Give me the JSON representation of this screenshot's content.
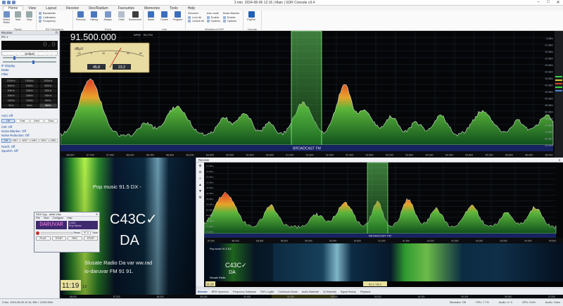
{
  "window": {
    "title": "3 min. 2024-08-06 12:16 | Main | SDR Console v3.4"
  },
  "menu": {
    "tabs": [
      "Home",
      "View",
      "Layout",
      "Receive",
      "Rec/Radium",
      "Favourites",
      "Memories",
      "Tools",
      "Help"
    ],
    "active_index": 0
  },
  "ribbon": {
    "groups": [
      {
        "name": "Radio",
        "buttons": [
          "Select Radio",
          "Start",
          "Stop"
        ]
      },
      {
        "name": "RX Frequency",
        "small": [
          "Bandwidth",
          "Calibration",
          "Frequency"
        ]
      },
      {
        "name": "Extra",
        "buttons": [
          "Previous",
          "History",
          "Always",
          "Child",
          "Screenshot"
        ]
      },
      {
        "name": "Link",
        "buttons": [
          "Radio",
          "Centre",
          "Program"
        ]
      },
      {
        "name": "Wideband DSP",
        "small": [
          "Receiver",
          "Lock All",
          "Unlock All",
          "Auto-mute",
          "Enable",
          "Options",
          "Noise Blanker",
          "Enable",
          "Options"
        ]
      },
      {
        "name": "Donate",
        "buttons": [
          "PayPal"
        ]
      }
    ]
  },
  "left_panel": {
    "receive_header": "Receive",
    "rx_label": "RX 1",
    "frequency_dim": "0.0",
    "frequency": "91.500.000",
    "rx_mode_label": "Default",
    "sections": [
      "IF Display",
      "Mode",
      "Filter"
    ],
    "bandwidths": [
      "200kHz",
      "150kHz",
      "100kHz",
      "80kHz",
      "60kHz",
      "50kHz",
      "40kHz",
      "30kHz",
      "25kHz",
      "20kHz",
      "18kHz",
      "15kHz",
      "12kHz",
      "10kHz",
      "8kHz",
      "7kHz",
      "6kHz",
      "5kHz"
    ],
    "selected_bandwidth_index": 17,
    "agc_title": "AGC Off",
    "agc_buttons": [
      "Off",
      "Fast",
      "Med",
      "Slow"
    ],
    "cw_title": "CW: Off",
    "noise_blanker_title": "Noise Blanker: Off",
    "noise_reduction_title": "Noise Reduction: Off",
    "nr_buttons": [
      "Off",
      "NR1",
      "NR2",
      "NR3",
      "NR4",
      "NR5"
    ],
    "notch_title": "Notch: Off",
    "squelch_title": "Squelch: Off"
  },
  "main_spectrum": {
    "frequency_display": "91.500.000",
    "mode_label": "WFM",
    "readout_tag": "BC-FM",
    "signal_meter": {
      "unit_label": "dBµV",
      "scale": [
        "-20",
        "0",
        "20",
        "40",
        "60",
        "80"
      ],
      "reading_left": "45.8",
      "reading_right": "23.2"
    },
    "db_labels": [
      "-5 dBm",
      "-10 dBm",
      "-15 dBm",
      "-20 dBm",
      "-25 dBm",
      "-30 dBm",
      "-35 dBm",
      "-40 dBm",
      "-45 dBm",
      "-50 dBm",
      "-55 dBm",
      "-60 dBm",
      "-65 dBm",
      "-70 dBm",
      "-75 dBm",
      "-80 dBm",
      "-85 dBm"
    ],
    "freq_labels": [
      "86.800",
      "87.200",
      "87.600",
      "88.000",
      "88.400",
      "88.800",
      "89.200",
      "89.600",
      "90.000",
      "90.400",
      "90.800",
      "91.200",
      "91.600",
      "92.000",
      "92.400",
      "92.800",
      "93.200",
      "93.600",
      "94.000",
      "94.400",
      "94.800",
      "95.200",
      "95.600",
      "96.000",
      "96.400"
    ],
    "band_label": "BROADCAST FM"
  },
  "rds_overlay": {
    "text_line1": "Pop music   91.5   DX  -",
    "callsign": "C43C✓",
    "callsign_sub": "DA",
    "text_line2": "Slusate Radio Da  var   ww.rad",
    "text_line3": "io-daruvar      FM 91      91.",
    "clock": "11:19",
    "clock_seconds": "13"
  },
  "rds_window": {
    "title": "RDS Spy - delta Vias",
    "menu": [
      "File",
      "View",
      "Configure",
      "Help"
    ],
    "station_name": "DARUVAR",
    "pi": "C43C",
    "pty": "Pop Music",
    "buttons": [
      "PLAY",
      "STOP",
      "Reset",
      "97.5",
      "Tune",
      "REC",
      "STOP"
    ]
  },
  "sub_panel": {
    "title": "Receive",
    "db_labels": [
      "-15 dBm",
      "-20 dBm",
      "-25 dBm",
      "-30 dBm",
      "-35 dBm",
      "-40 dBm",
      "-45 dBm",
      "-50 dBm",
      "-55 dBm",
      "-60 dBm",
      "-65 dBm",
      "-70 dBm",
      "-75 dBm"
    ],
    "freq_labels": [
      "87.500",
      "88.000",
      "88.500",
      "89.000",
      "89.500",
      "90.000",
      "90.500",
      "91.000",
      "91.500",
      "92.000",
      "92.500",
      "93.000",
      "93.500",
      "94.000",
      "94.500"
    ],
    "band_label": "BROADCAST FM",
    "mini_overlay": {
      "text": "Pop music  91.5  DX",
      "callsign": "C43C✓",
      "sub": "DA",
      "tag": "Slusate Radio",
      "clock": "11:19"
    },
    "marker": "91.1 / 92.1",
    "tabs": [
      "Receive",
      "BPM Spectrum",
      "Frequency Database",
      "RDS Logfile",
      "Continuum Mode",
      "Audio Waterfall",
      "IQ Waterfall",
      "Signal History",
      "Playback"
    ]
  },
  "waterfall_freq_labels": [
    "86.000",
    "87.000",
    "88.000",
    "89.000",
    "90.000",
    "91.000",
    "92.000",
    "93.000",
    "94.000",
    "95.000",
    "96.000",
    "97.000"
  ],
  "status_bar": {
    "left": "3 min. 2024-08-06 12:16, BW = 3,000 MHz",
    "items": [
      "Simulator: Off",
      "CPU: 7.7%",
      "Audio: 0 / 0",
      "GPU: 9.6%",
      "Audio: 10ms"
    ]
  },
  "colors": {
    "accent": "#2b5fb8",
    "spectrum_peak": "#d83224",
    "spectrum_mid": "#f0c030",
    "spectrum_low": "#1e8a30",
    "band_bar": "#172260",
    "selection": "#5ccc4c"
  }
}
